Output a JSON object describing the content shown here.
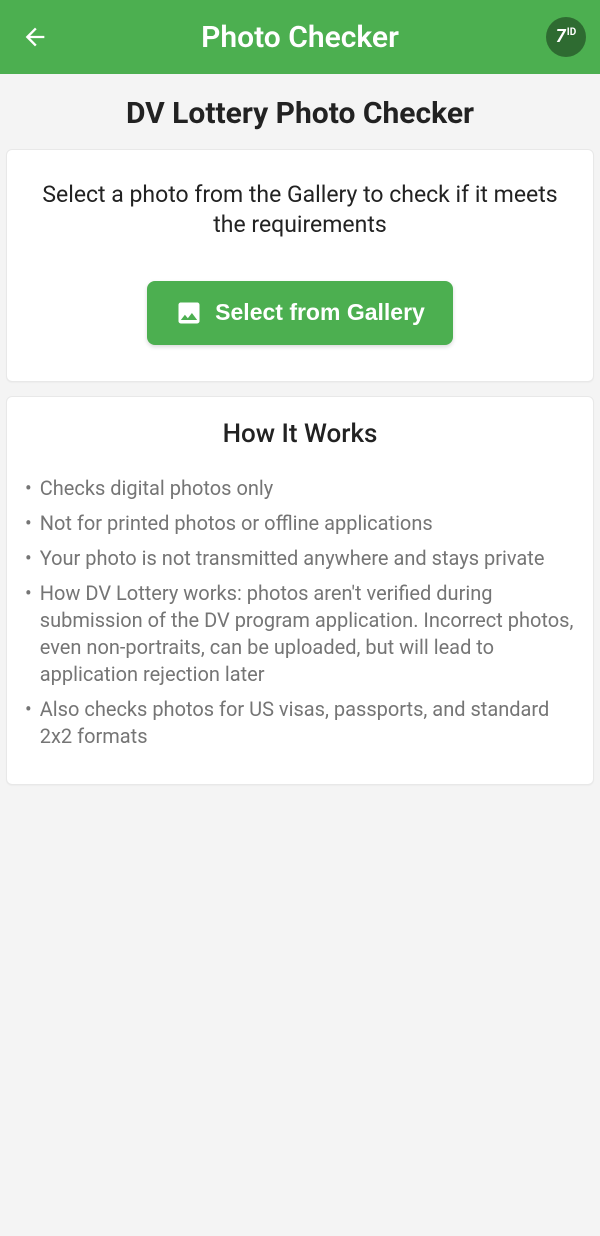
{
  "header": {
    "title": "Photo Checker",
    "logo_text": "7",
    "logo_suffix": "ID"
  },
  "page": {
    "title": "DV Lottery Photo Checker"
  },
  "select_card": {
    "prompt": "Select a photo from the Gallery to check if it meets the requirements",
    "button_label": "Select from Gallery"
  },
  "info_card": {
    "title": "How It Works",
    "items": [
      "Checks digital photos only",
      "Not for printed photos or offline applications",
      "Your photo is not transmitted anywhere and stays private",
      "How DV Lottery works: photos aren't verified during submission of the DV program application. Incorrect photos, even non-portraits, can be uploaded, but will lead to application rejection later",
      "Also checks photos for US visas, passports, and standard 2x2 formats"
    ]
  },
  "colors": {
    "primary": "#4caf50",
    "logo_bg": "#2e6b31",
    "text_muted": "#757575"
  }
}
